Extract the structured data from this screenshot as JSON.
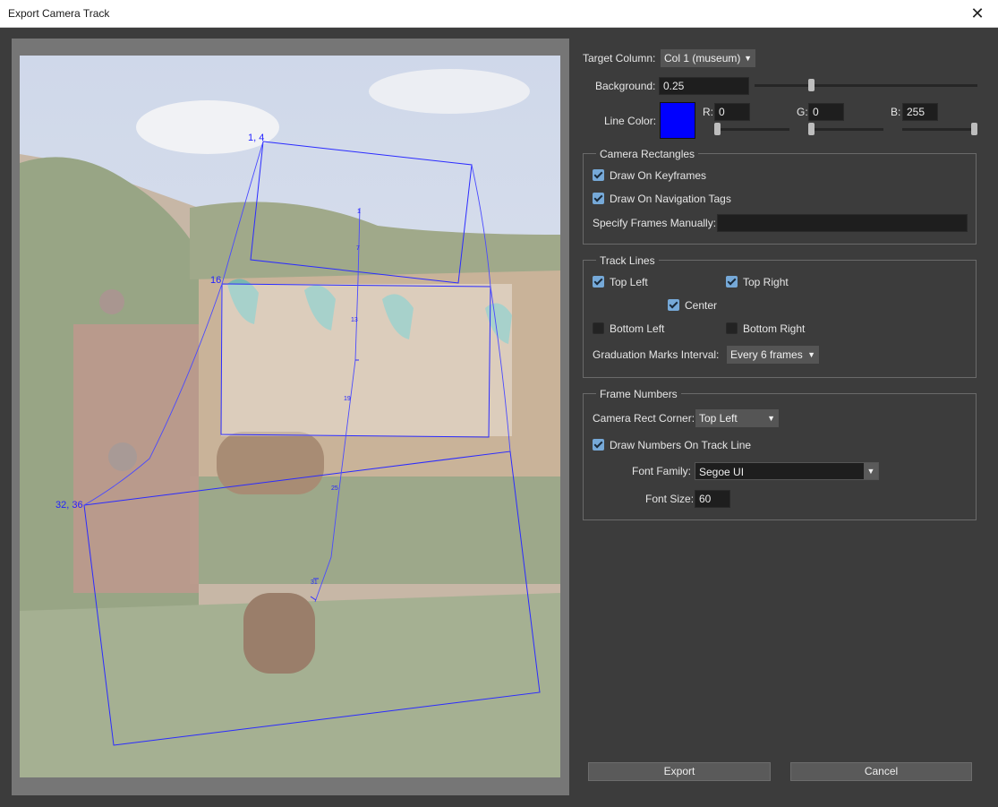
{
  "window": {
    "title": "Export Camera Track",
    "close_glyph": "✕"
  },
  "colors": {
    "line_color": "#0000ff",
    "accent": "#76a9d8"
  },
  "preview": {
    "labels": {
      "tl_keyframe_a": "1, 4",
      "tl_keyframe_b": "16",
      "tl_keyframe_c": "32, 36",
      "grad_1": "1",
      "grad_7": "7",
      "grad_13": "13",
      "grad_19": "19",
      "grad_25": "25",
      "grad_31": "31"
    }
  },
  "settings": {
    "target_column": {
      "label": "Target Column:",
      "value": "Col 1 (museum)"
    },
    "background": {
      "label": "Background:",
      "value": "0.25",
      "slider_fraction": 0.25
    },
    "line_color": {
      "label": "Line Color:",
      "r": {
        "label": "R:",
        "value": "0",
        "slider_fraction": 0
      },
      "g": {
        "label": "G:",
        "value": "0",
        "slider_fraction": 0
      },
      "b": {
        "label": "B:",
        "value": "255",
        "slider_fraction": 1
      }
    }
  },
  "camera_rectangles": {
    "title": "Camera Rectangles",
    "draw_on_keyframes": {
      "label": "Draw On Keyframes",
      "checked": true
    },
    "draw_on_nav_tags": {
      "label": "Draw On Navigation Tags",
      "checked": true
    },
    "specify_frames": {
      "label": "Specify Frames Manually:",
      "value": ""
    }
  },
  "track_lines": {
    "title": "Track Lines",
    "top_left": {
      "label": "Top Left",
      "checked": true
    },
    "top_right": {
      "label": "Top Right",
      "checked": true
    },
    "center": {
      "label": "Center",
      "checked": true
    },
    "bottom_left": {
      "label": "Bottom Left",
      "checked": false
    },
    "bottom_right": {
      "label": "Bottom Right",
      "checked": false
    },
    "graduation": {
      "label": "Graduation Marks Interval:",
      "value": "Every 6 frames"
    }
  },
  "frame_numbers": {
    "title": "Frame Numbers",
    "corner": {
      "label": "Camera Rect Corner:",
      "value": "Top Left"
    },
    "draw_numbers": {
      "label": "Draw Numbers On Track Line",
      "checked": true
    },
    "font_family": {
      "label": "Font Family:",
      "value": "Segoe UI"
    },
    "font_size": {
      "label": "Font Size:",
      "value": "60"
    }
  },
  "buttons": {
    "export": "Export",
    "cancel": "Cancel"
  }
}
